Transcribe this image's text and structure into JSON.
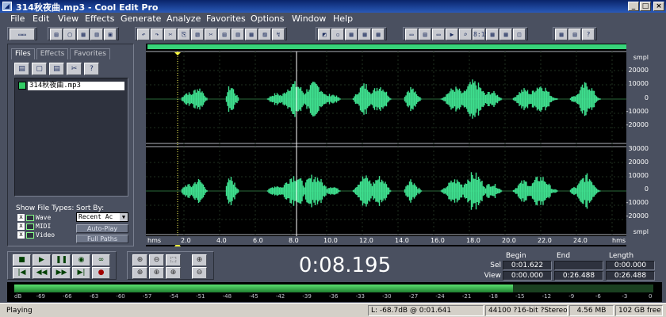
{
  "window": {
    "title": "314秋夜曲.mp3 - Cool Edit Pro",
    "minimize": "_",
    "maximize": "□",
    "close": "×"
  },
  "menu": [
    "File",
    "Edit",
    "View",
    "Effects",
    "Generate",
    "Analyze",
    "Favorites",
    "Options",
    "Window",
    "Help"
  ],
  "panel": {
    "tabs": [
      "Files",
      "Effects",
      "Favorites"
    ],
    "files": [
      "314秋夜曲.mp3"
    ],
    "show_file_types_label": "Show File Types:",
    "sort_by_label": "Sort By:",
    "file_types": [
      {
        "label": "Wave",
        "checked": "x"
      },
      {
        "label": "MIDI",
        "checked": "x"
      },
      {
        "label": "Video",
        "checked": "x"
      }
    ],
    "sort_value": "Recent Ac",
    "auto_play": "Auto-Play",
    "full_paths": "Full Paths"
  },
  "waveform": {
    "color": "#3fe08f",
    "scale_unit": "smpl",
    "scale_labels_top": [
      "smpl",
      "20000",
      "10000",
      "0",
      "-10000",
      "-20000"
    ],
    "scale_labels_bottom": [
      "30000",
      "20000",
      "10000",
      "0",
      "-10000",
      "-20000",
      "smpl"
    ],
    "time_unit": "hms",
    "time_labels": [
      "hms",
      "2.0",
      "4.0",
      "6.0",
      "8.0",
      "10.0",
      "12.0",
      "14.0",
      "16.0",
      "18.0",
      "20.0",
      "22.0",
      "24.0",
      "hms"
    ]
  },
  "transport": {
    "row1": [
      "■",
      "▶",
      "❚❚",
      "◉",
      "∞"
    ],
    "row2": [
      "|◀",
      "◀◀",
      "▶▶",
      "▶|",
      "●"
    ]
  },
  "zoom": {
    "row1": [
      "⊕",
      "⊖",
      "⬚",
      "⊕"
    ],
    "row2": [
      "⊕",
      "⊕",
      "⊕",
      "⊖"
    ]
  },
  "time_display": "0:08.195",
  "selection": {
    "headers": [
      "Begin",
      "End",
      "Length"
    ],
    "sel_label": "Sel",
    "view_label": "View",
    "sel": [
      "0:01.622",
      "",
      "0:00.000"
    ],
    "view": [
      "0:00.000",
      "0:26.488",
      "0:26.488"
    ]
  },
  "meter": {
    "labels": [
      "dB",
      "-69",
      "-66",
      "-63",
      "-60",
      "-57",
      "-54",
      "-51",
      "-48",
      "-45",
      "-42",
      "-39",
      "-36",
      "-33",
      "-30",
      "-27",
      "-24",
      "-21",
      "-18",
      "-15",
      "-12",
      "-9",
      "-6",
      "-3",
      "0"
    ],
    "level_fraction": 0.78
  },
  "status": {
    "state": "Playing",
    "level_pos": "L: -68.7dB @ 0:01.641",
    "format": "44100 ?16-bit ?Stereo",
    "size": "4.56 MB",
    "free": "102 GB free"
  },
  "toolbar": {
    "groups": [
      [
        "▭▭"
      ],
      [
        "▤",
        "▢",
        "▦",
        "▥",
        "▣"
      ],
      [
        "↶",
        "↷",
        "✂",
        "⎘",
        "▧",
        "✂",
        "▤",
        "▥",
        "▦",
        "▨",
        "↯"
      ],
      [
        "◩",
        "▫",
        "▦",
        "▦",
        "▦"
      ],
      [
        "▭",
        "▤",
        "▭",
        "▶",
        "⌕",
        "8:15",
        "▦",
        "▦",
        "◫"
      ],
      [
        "▦",
        "▤",
        "?"
      ]
    ]
  },
  "panel_toolbar": [
    "▤",
    "▢",
    "▤",
    "✂",
    "?"
  ]
}
